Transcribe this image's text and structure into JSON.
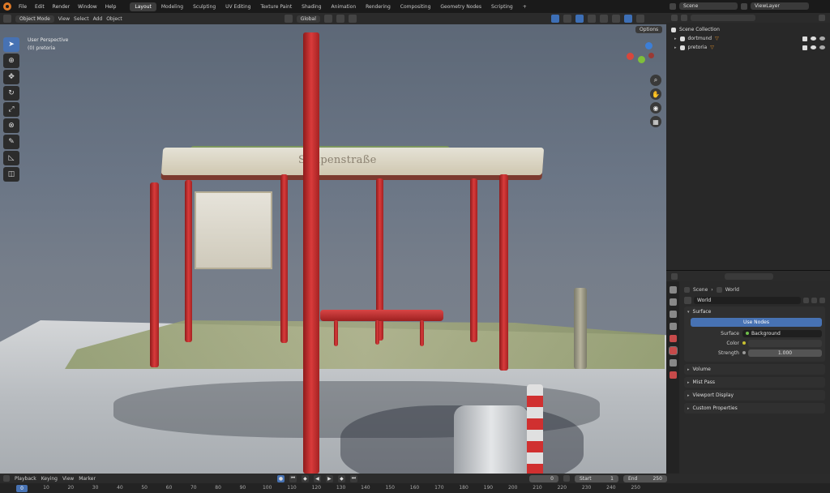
{
  "topbar": {
    "menus": [
      "File",
      "Edit",
      "Render",
      "Window",
      "Help"
    ],
    "workspaces": [
      "Layout",
      "Modeling",
      "Sculpting",
      "UV Editing",
      "Texture Paint",
      "Shading",
      "Animation",
      "Rendering",
      "Compositing",
      "Geometry Nodes",
      "Scripting"
    ],
    "active_workspace": "Layout",
    "add_tab": "+",
    "scene_name": "Scene",
    "view_layer": "ViewLayer"
  },
  "viewport_header": {
    "mode": "Object Mode",
    "menus": [
      "View",
      "Select",
      "Add",
      "Object"
    ],
    "orientation": "Global",
    "options": "Options"
  },
  "viewport": {
    "perspective_label": "User Perspective",
    "object_label": "(0) pretoria",
    "roof_text": "Stolpenstraße",
    "axes": {
      "x_color": "#d8473c",
      "y_color": "#7fbf3a",
      "z_color": "#3c7fd8"
    }
  },
  "toolbar": {
    "tools": [
      "select-tool",
      "cursor-tool",
      "move-tool",
      "rotate-tool",
      "scale-tool",
      "transform-tool",
      "annotate-tool",
      "measure-tool",
      "add-cube-tool"
    ],
    "glyphs": [
      "➤",
      "⊕",
      "✥",
      "↻",
      "⤢",
      "⊗",
      "✎",
      "◺",
      "◫"
    ]
  },
  "outliner": {
    "root": "Scene Collection",
    "items": [
      {
        "name": "dortmund"
      },
      {
        "name": "pretoria"
      }
    ]
  },
  "properties": {
    "breadcrumb_scene": "Scene",
    "breadcrumb_world": "World",
    "world_name": "World",
    "surface_panel": "Surface",
    "use_nodes_label": "Use Nodes",
    "surface_label": "Surface",
    "surface_value": "Background",
    "color_label": "Color",
    "strength_label": "Strength",
    "strength_value": "1.000",
    "collapsed_panels": [
      "Volume",
      "Mist Pass",
      "Viewport Display",
      "Custom Properties"
    ]
  },
  "timeline": {
    "menus": [
      "Playback",
      "Keying",
      "View",
      "Marker"
    ],
    "current_frame": "0",
    "start_label": "Start",
    "start_value": "1",
    "end_label": "End",
    "end_value": "250",
    "ruler_ticks": [
      "10",
      "20",
      "30",
      "40",
      "50",
      "60",
      "70",
      "80",
      "90",
      "100",
      "110",
      "120",
      "130",
      "140",
      "150",
      "160",
      "170",
      "180",
      "190",
      "200",
      "210",
      "220",
      "230",
      "240",
      "250"
    ],
    "frame_marker": "0"
  },
  "colors": {
    "accent": "#4772b3",
    "pole_red": "#d93b3b",
    "logo_orange": "#e07a27"
  }
}
